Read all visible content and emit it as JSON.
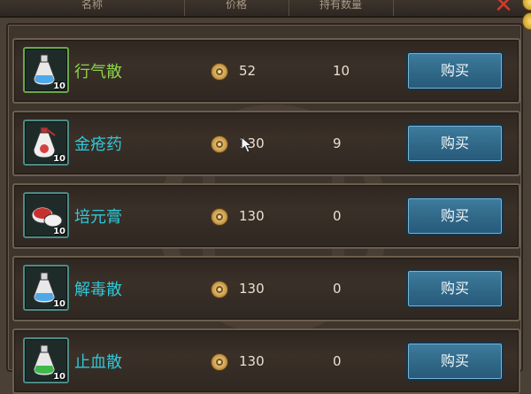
{
  "header": {
    "col_name": "名称",
    "col_price": "价格",
    "col_held": "持有数量"
  },
  "items": [
    {
      "name": "行气散",
      "price": "52",
      "held": "10",
      "qty": "10",
      "buy": "购买",
      "icon": "bottle-blue-icon",
      "color": "#8bd64a"
    },
    {
      "name": "金疮药",
      "price": "130",
      "held": "9",
      "qty": "10",
      "buy": "购买",
      "icon": "bottle-red-icon",
      "color": "#2fc8d8"
    },
    {
      "name": "培元膏",
      "price": "130",
      "held": "0",
      "qty": "10",
      "buy": "购买",
      "icon": "ointment-icon",
      "color": "#2fc8d8"
    },
    {
      "name": "解毒散",
      "price": "130",
      "held": "0",
      "qty": "10",
      "buy": "购买",
      "icon": "bottle-blue-icon",
      "color": "#2fc8d8"
    },
    {
      "name": "止血散",
      "price": "130",
      "held": "0",
      "qty": "10",
      "buy": "购买",
      "icon": "bottle-green-icon",
      "color": "#2fc8d8"
    }
  ]
}
